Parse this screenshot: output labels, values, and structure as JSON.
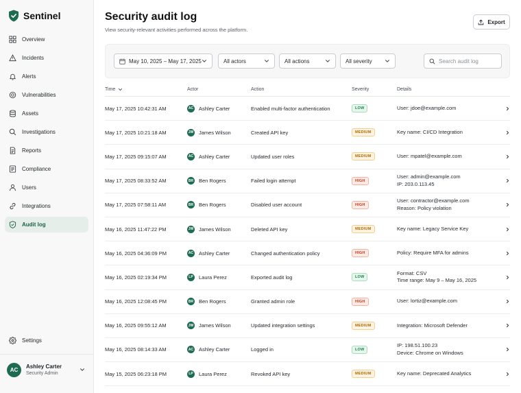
{
  "brand": {
    "name": "Sentinel",
    "color": "#1f6b52"
  },
  "nav": {
    "items": [
      {
        "key": "overview",
        "label": "Overview",
        "icon": "grid-icon",
        "active": false
      },
      {
        "key": "incidents",
        "label": "Incidents",
        "icon": "warning-icon",
        "active": false
      },
      {
        "key": "alerts",
        "label": "Alerts",
        "icon": "bell-icon",
        "active": false
      },
      {
        "key": "vulnerabilities",
        "label": "Vulnerabilities",
        "icon": "bug-icon",
        "active": false
      },
      {
        "key": "assets",
        "label": "Assets",
        "icon": "database-icon",
        "active": false
      },
      {
        "key": "investigations",
        "label": "Investigations",
        "icon": "search-icon",
        "active": false
      },
      {
        "key": "reports",
        "label": "Reports",
        "icon": "document-icon",
        "active": false
      },
      {
        "key": "compliance",
        "label": "Compliance",
        "icon": "checklist-icon",
        "active": false
      },
      {
        "key": "users",
        "label": "Users",
        "icon": "user-icon",
        "active": false
      },
      {
        "key": "integrations",
        "label": "Integrations",
        "icon": "link-icon",
        "active": false
      },
      {
        "key": "audit-log",
        "label": "Audit log",
        "icon": "shield-check-icon",
        "active": true
      }
    ],
    "settings": {
      "label": "Settings",
      "icon": "gear-icon"
    }
  },
  "profile": {
    "initials": "AC",
    "name": "Ashley Carter",
    "role": "Security Admin"
  },
  "header": {
    "title": "Security audit log",
    "subtitle": "View security-relevant activities performed across the platform.",
    "export_label": "Export"
  },
  "filters": {
    "date_range": "May 10, 2025 – May 17, 2025",
    "actors": "All actors",
    "actions": "All actions",
    "severity": "All severity",
    "search_placeholder": "Search audit log"
  },
  "table": {
    "columns": {
      "time": "Time",
      "actor": "Actor",
      "action": "Action",
      "severity": "Severity",
      "details": "Details"
    },
    "rows": [
      {
        "time": "May 17, 2025 10:42:31 AM",
        "initials": "AC",
        "actor": "Ashley Carter",
        "action": "Enabled multi-factor authentication",
        "severity": "LOW",
        "level": "low",
        "d1": "User: jdoe@example.com",
        "d2": ""
      },
      {
        "time": "May 17, 2025 10:21:18 AM",
        "initials": "JW",
        "actor": "James Wilson",
        "action": "Created API key",
        "severity": "MEDIUM",
        "level": "medium",
        "d1": "Key name: CI/CD Integration",
        "d2": ""
      },
      {
        "time": "May 17, 2025 09:15:07 AM",
        "initials": "AC",
        "actor": "Ashley Carter",
        "action": "Updated user roles",
        "severity": "MEDIUM",
        "level": "medium",
        "d1": "User: mpatel@example.com",
        "d2": ""
      },
      {
        "time": "May 17, 2025 08:33:52 AM",
        "initials": "BR",
        "actor": "Ben Rogers",
        "action": "Failed login attempt",
        "severity": "HIGH",
        "level": "high",
        "d1": "User: admin@example.com",
        "d2": "IP: 203.0.113.45"
      },
      {
        "time": "May 17, 2025 07:58:11 AM",
        "initials": "BR",
        "actor": "Ben Rogers",
        "action": "Disabled user account",
        "severity": "HIGH",
        "level": "high",
        "d1": "User: contractor@example.com",
        "d2": "Reason:  Policy violation"
      },
      {
        "time": "May 16, 2025 11:47:22 PM",
        "initials": "JW",
        "actor": "James Wilson",
        "action": "Deleted API key",
        "severity": "MEDIUM",
        "level": "medium",
        "d1": "Key name: Legacy Service Key",
        "d2": ""
      },
      {
        "time": "May 16, 2025 04:36:09 PM",
        "initials": "AC",
        "actor": "Ashley Carter",
        "action": "Changed authentication policy",
        "severity": "HIGH",
        "level": "high",
        "d1": "Policy: Require MFA for admins",
        "d2": ""
      },
      {
        "time": "May 16, 2025 02:19:34 PM",
        "initials": "LP",
        "actor": "Laura Perez",
        "action": "Exported audit log",
        "severity": "LOW",
        "level": "low",
        "d1": "Format: CSV",
        "d2": "Time range: May 9 – May 16, 2025"
      },
      {
        "time": "May 16, 2025 12:08:45 PM",
        "initials": "BR",
        "actor": "Ben Rogers",
        "action": "Granted admin role",
        "severity": "HIGH",
        "level": "high",
        "d1": "User: lortiz@example.com",
        "d2": ""
      },
      {
        "time": "May 16, 2025 09:55:12 AM",
        "initials": "JW",
        "actor": "James Wilson",
        "action": "Updated integration settings",
        "severity": "MEDIUM",
        "level": "medium",
        "d1": "Integration: Microsoft Defender",
        "d2": ""
      },
      {
        "time": "May 16, 2025 08:14:33 AM",
        "initials": "AC",
        "actor": "Ashley Carter",
        "action": "Logged in",
        "severity": "LOW",
        "level": "low",
        "d1": "IP: 198.51.100.23",
        "d2": "Device: Chrome on Windows"
      },
      {
        "time": "May 15, 2025 06:23:18 PM",
        "initials": "LP",
        "actor": "Laura Perez",
        "action": "Revoked API key",
        "severity": "MEDIUM",
        "level": "medium",
        "d1": "Key name: Deprecated Analytics",
        "d2": ""
      }
    ]
  }
}
